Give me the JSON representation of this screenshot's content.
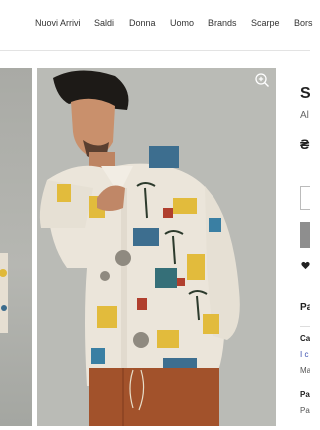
{
  "nav": {
    "items": [
      {
        "label": "Nuovi Arrivi",
        "key": "nuovi-arrivi"
      },
      {
        "label": "Saldi",
        "key": "saldi"
      },
      {
        "label": "Donna",
        "key": "donna"
      },
      {
        "label": "Uomo",
        "key": "uomo"
      },
      {
        "label": "Brands",
        "key": "brands"
      },
      {
        "label": "Scarpe",
        "key": "scarpe"
      },
      {
        "label": "Bors",
        "key": "borse"
      }
    ]
  },
  "product": {
    "title_fragment": "S",
    "brand_fragment": "Al",
    "price_fragment": "₴",
    "section_fragment": "Pa",
    "attr1_label_fragment": "Ca",
    "attr1_value_fragment": "I c",
    "attr1_value2_fragment": "Ma",
    "attr2_label_fragment": "Pa",
    "attr2_value_fragment": "Pa"
  },
  "icons": {
    "zoom": "zoom-in-icon",
    "wishlist": "heart-icon"
  },
  "colors": {
    "nav_border": "#e3e3e3",
    "cart_button": "#8e8e8e",
    "shirt_base": "#e9e3d8",
    "pants": "#a2522b"
  }
}
